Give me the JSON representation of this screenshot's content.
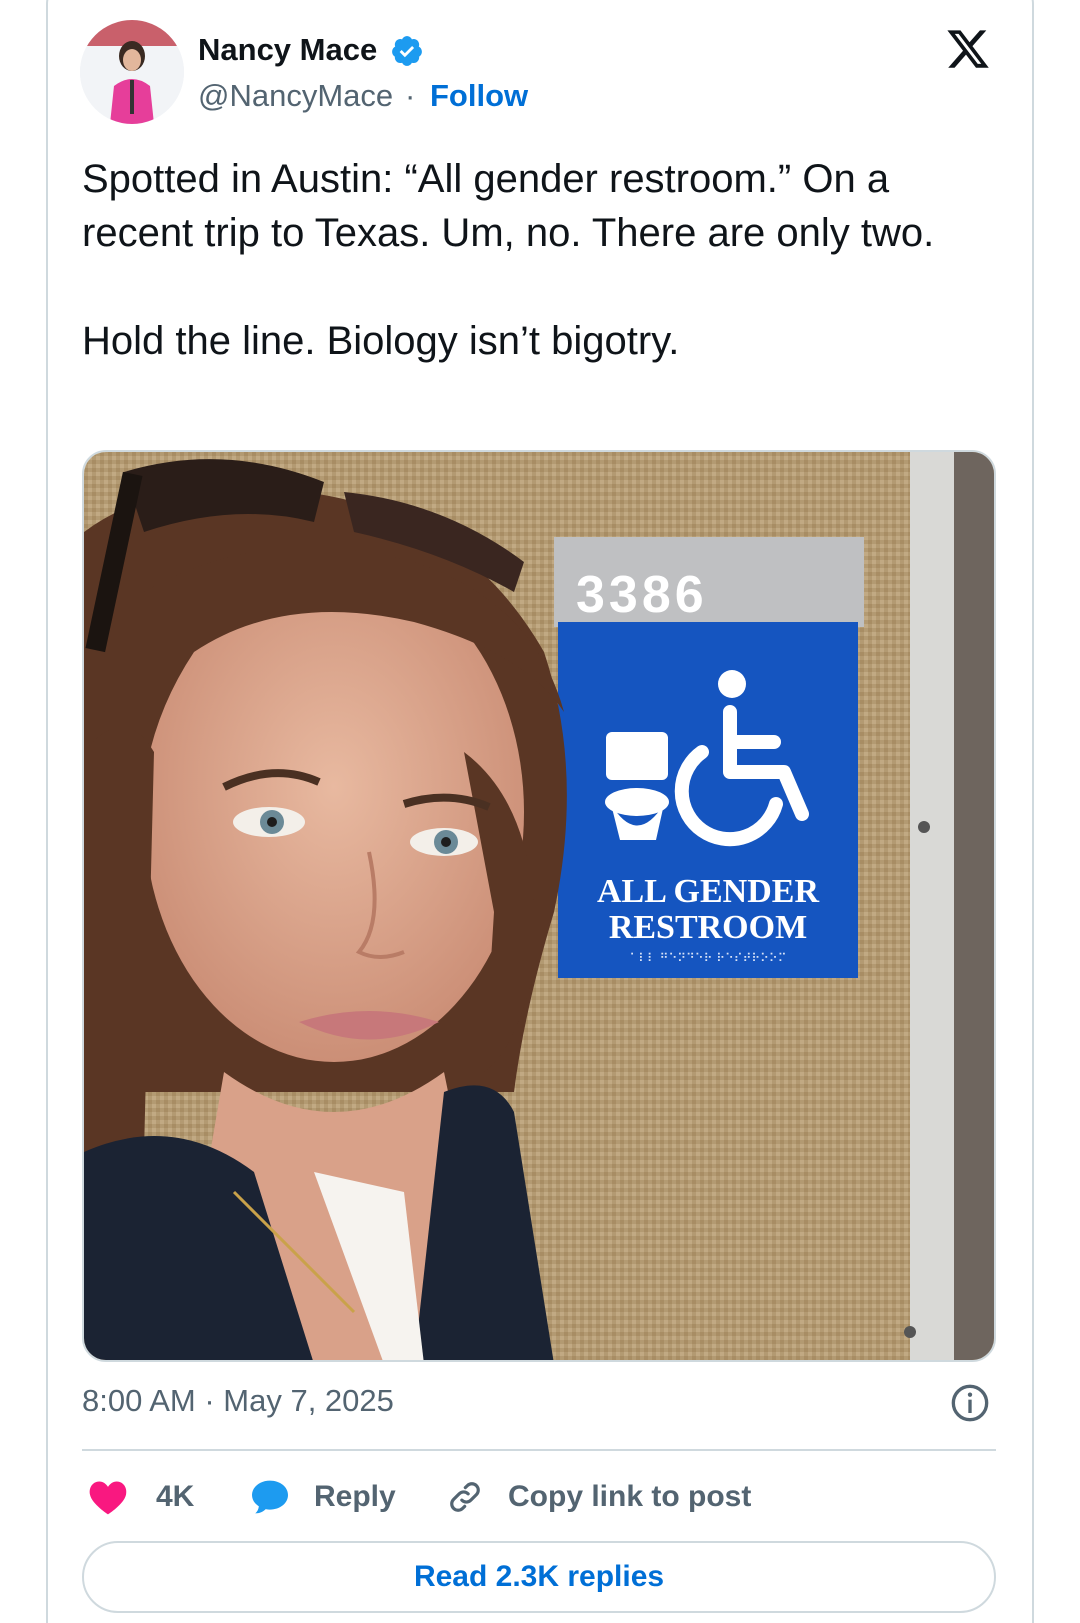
{
  "author": {
    "name": "Nancy Mace",
    "handle": "@NancyMace",
    "separator": "·",
    "follow_label": "Follow"
  },
  "tweet": {
    "text_line1": "Spotted in Austin: “All gender restroom.” On a recent trip to Texas. Um, no. There are only two.",
    "text_line2": "Hold the line. Biology isn’t bigotry."
  },
  "media": {
    "room_number": "3386",
    "sign_line1": "ALL GENDER",
    "sign_line2": "RESTROOM",
    "braille": "⠁⠇⠇ ⠛⠑⠝⠙⠑⠗ ⠗⠑⠎⠞⠗⠕⠕⠍"
  },
  "meta": {
    "timestamp": "8:00 AM · May 7, 2025"
  },
  "actions": {
    "like_count": "4K",
    "reply_label": "Reply",
    "copy_label": "Copy link to post"
  },
  "read_replies_label": "Read 2.3K replies",
  "colors": {
    "accent": "#006fd6",
    "like": "#f91880",
    "reply": "#1d9bf0",
    "sign_blue": "#1555c0",
    "text_primary": "#0f1419",
    "text_secondary": "#536471",
    "border": "#cfd9de"
  },
  "icons": {
    "verified": "verified-badge-icon",
    "x_logo": "x-logo-icon",
    "info": "info-icon",
    "like": "heart-icon",
    "reply": "speech-bubble-icon",
    "copy": "link-icon"
  }
}
